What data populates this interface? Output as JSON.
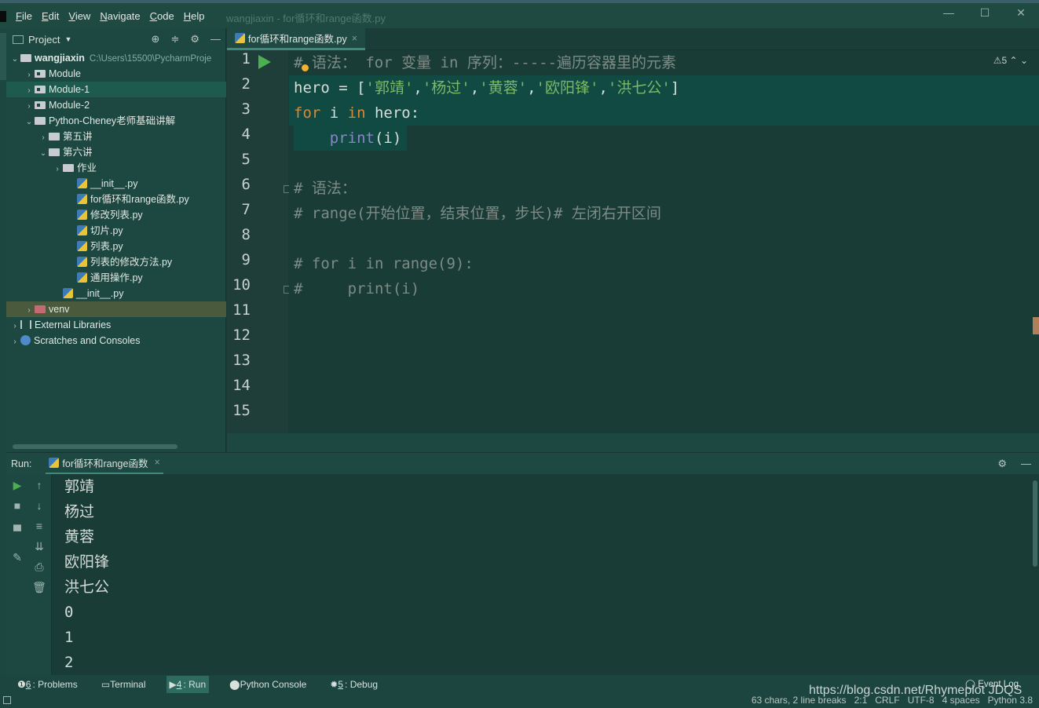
{
  "window": {
    "menu": [
      "File",
      "Edit",
      "View",
      "Navigate",
      "Code",
      "Help"
    ],
    "title": "wangjiaxin - for循环和range函数.py",
    "controls": [
      "—",
      "☐",
      "✕"
    ]
  },
  "project": {
    "header": "Project",
    "tree": [
      {
        "label": "wangjiaxin",
        "path": "C:\\Users\\15500\\PycharmProje",
        "type": "root",
        "indent": 0
      },
      {
        "label": "Module",
        "type": "folder",
        "indent": 1
      },
      {
        "label": "Module-1",
        "type": "folder",
        "indent": 1,
        "selected": true
      },
      {
        "label": "Module-2",
        "type": "folder",
        "indent": 1
      },
      {
        "label": "Python-Cheney老师基础讲解",
        "type": "folder-open",
        "indent": 1
      },
      {
        "label": "第五讲",
        "type": "folder",
        "indent": 2
      },
      {
        "label": "第六讲",
        "type": "folder-open",
        "indent": 2
      },
      {
        "label": "作业",
        "type": "folder",
        "indent": 3
      },
      {
        "label": "__init__.py",
        "type": "py",
        "indent": 4
      },
      {
        "label": "for循环和range函数.py",
        "type": "py",
        "indent": 4
      },
      {
        "label": "修改列表.py",
        "type": "py",
        "indent": 4
      },
      {
        "label": "切片.py",
        "type": "py",
        "indent": 4
      },
      {
        "label": "列表.py",
        "type": "py",
        "indent": 4
      },
      {
        "label": "列表的修改方法.py",
        "type": "py",
        "indent": 4
      },
      {
        "label": "通用操作.py",
        "type": "py",
        "indent": 4
      },
      {
        "label": "__init__.py",
        "type": "py",
        "indent": 3
      },
      {
        "label": "venv",
        "type": "venv",
        "indent": 1
      },
      {
        "label": "External Libraries",
        "type": "lib",
        "indent": 0
      },
      {
        "label": "Scratches and Consoles",
        "type": "scratch",
        "indent": 0
      }
    ]
  },
  "editor": {
    "tab": "for循环和range函数.py",
    "warnings": "⚠5",
    "line_numbers": [
      "1",
      "2",
      "3",
      "4",
      "5",
      "6",
      "7",
      "8",
      "9",
      "10",
      "11",
      "12",
      "13",
      "14",
      "15"
    ]
  },
  "run": {
    "label": "Run:",
    "tab": "for循环和range函数",
    "output": [
      "郭靖",
      "杨过",
      "黄蓉",
      "欧阳锋",
      "洪七公",
      "0",
      "1",
      "2"
    ]
  },
  "toolwindows": [
    {
      "num": "6",
      "label": ": Problems"
    },
    {
      "num": "",
      "label": "Terminal"
    },
    {
      "num": "4",
      "label": ": Run",
      "active": true
    },
    {
      "num": "",
      "label": "Python Console"
    },
    {
      "num": "5",
      "label": ": Debug"
    }
  ],
  "event_log": "Event Log",
  "status": [
    "63 chars, 2 line breaks",
    "2:1",
    "CRLF",
    "UTF-8",
    "4 spaces",
    "Python 3.8"
  ],
  "watermark": "https://blog.csdn.net/Rhymeplot  JDQS"
}
